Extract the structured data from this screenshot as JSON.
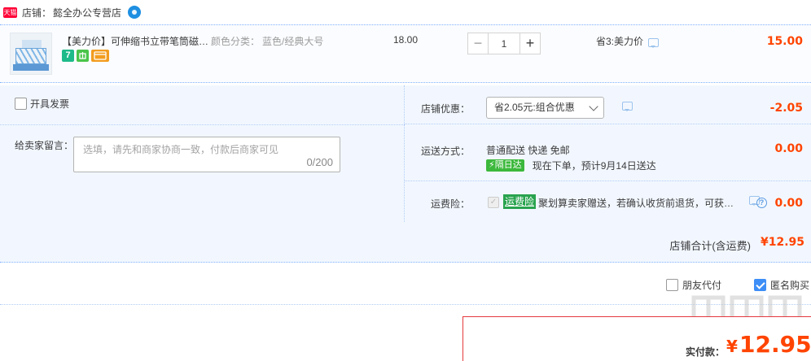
{
  "shop": {
    "badge": "天猫",
    "label": "店铺：",
    "name": "懿全办公专营店"
  },
  "item": {
    "title": "【美力价】可伸缩书立带笔筒磁…",
    "sku_label": "颜色分类：",
    "sku_value": "蓝色/经典大号",
    "unit_price": "18.00",
    "quantity": "1",
    "minus": "−",
    "plus": "+",
    "promo": "省3:美力价",
    "total": "15.00",
    "badges": [
      "7",
      "",
      ""
    ]
  },
  "options": {
    "invoice_label": "开具发票",
    "message_label": "给卖家留言：",
    "message_placeholder": "选填，请先和商家协商一致，付款后商家可见",
    "message_count": "0/200",
    "discount_label": "店铺优惠：",
    "discount_value": "省2.05元:组合优惠",
    "discount_amount": "-2.05",
    "shipping_label": "运送方式：",
    "shipping_method": "普通配送 快递 免邮",
    "shipping_badge": "隔日达",
    "shipping_eta": "现在下单，预计9月14日送达",
    "shipping_amount": "0.00",
    "insurance_label": "运费险：",
    "insurance_tag": "运费险",
    "insurance_text": "聚划算卖家赠送，若确认收货前退货，可获…",
    "insurance_amount": "0.00",
    "insurance_help": "?"
  },
  "store_total": {
    "label": "店铺合计(含运费)",
    "amount": "¥12.95"
  },
  "bottom": {
    "friend_pay": "朋友代付",
    "anonymous": "匿名购买"
  },
  "pay": {
    "label": "实付款：",
    "currency": "¥",
    "amount": "12.95"
  },
  "colors": {
    "price_red": "#ff4400",
    "accent_blue": "#3e8ef7",
    "row_bg": "#f2f7ff"
  }
}
